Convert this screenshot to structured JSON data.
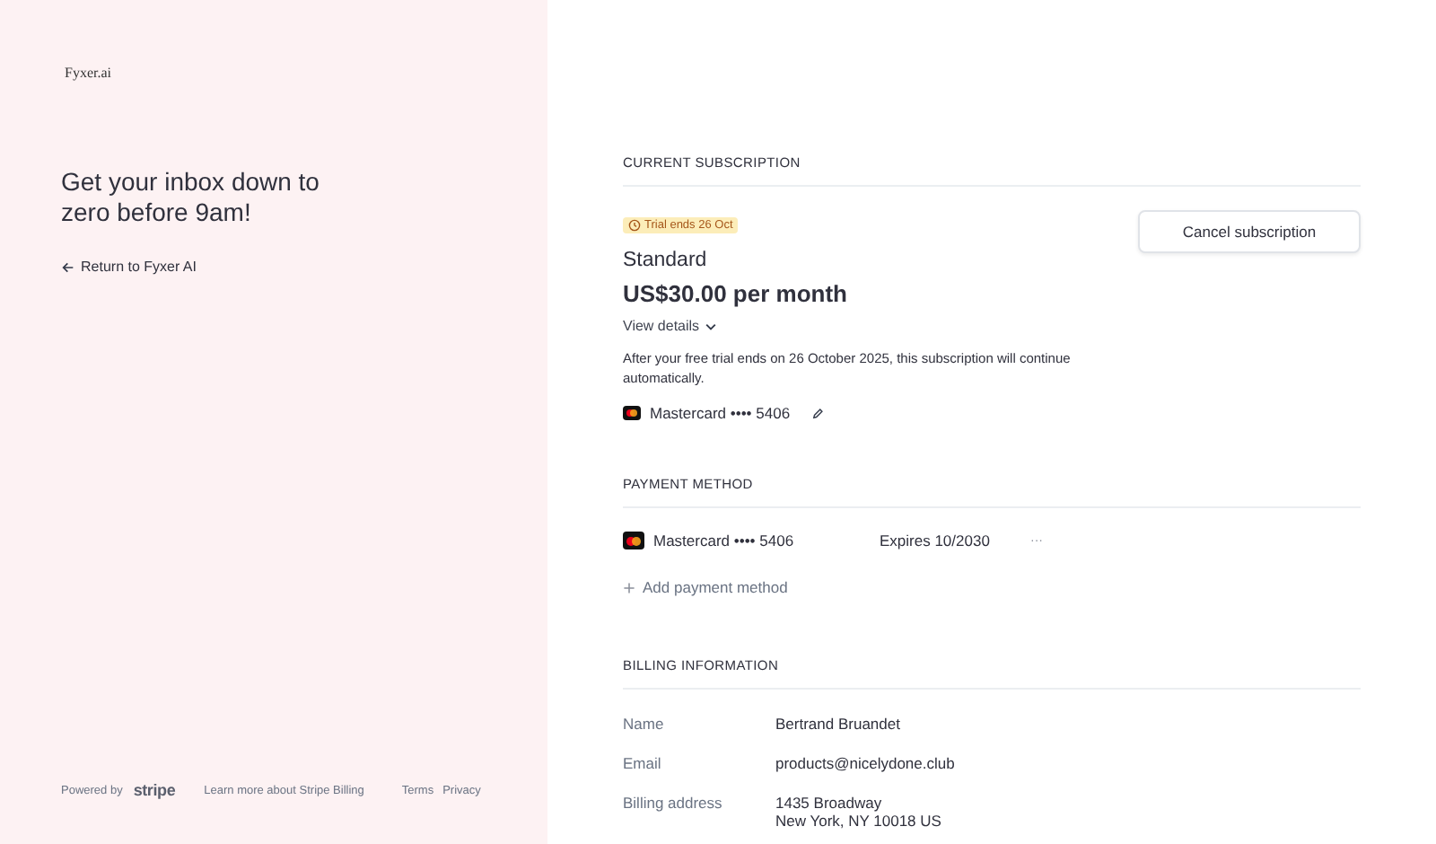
{
  "sidebar": {
    "logo": "Fyxer.ai",
    "headline": "Get your inbox down to zero before 9am!",
    "return_link": "Return to Fyxer AI",
    "footer": {
      "powered_by": "Powered by",
      "brand": "stripe",
      "link_groups": [
        [
          "Learn more about Stripe Billing"
        ],
        [
          "Terms",
          "Privacy"
        ]
      ]
    }
  },
  "current_subscription": {
    "heading": "CURRENT SUBSCRIPTION",
    "badge": "Trial ends 26 Oct",
    "plan": "Standard",
    "price": "US$30.00 per month",
    "details_toggle": "View details",
    "expanded": false,
    "note": "After your free trial ends on 26 October 2025, this subscription will continue automatically.",
    "card": "Mastercard •••• 5406",
    "cancel_button": "Cancel subscription"
  },
  "payment_method": {
    "heading": "PAYMENT METHOD",
    "cards": [
      {
        "label": "Mastercard •••• 5406",
        "expires": "Expires 10/2030",
        "menu": "···"
      }
    ],
    "add_button": "Add payment method"
  },
  "billing_information": {
    "heading": "BILLING INFORMATION",
    "fields": [
      {
        "label": "Name",
        "value": [
          "Bertrand Bruandet"
        ]
      },
      {
        "label": "Email",
        "value": [
          "products@nicelydone.club"
        ]
      },
      {
        "label": "Billing address",
        "value": [
          "1435 Broadway",
          "New York, NY 10018 US"
        ]
      }
    ]
  }
}
